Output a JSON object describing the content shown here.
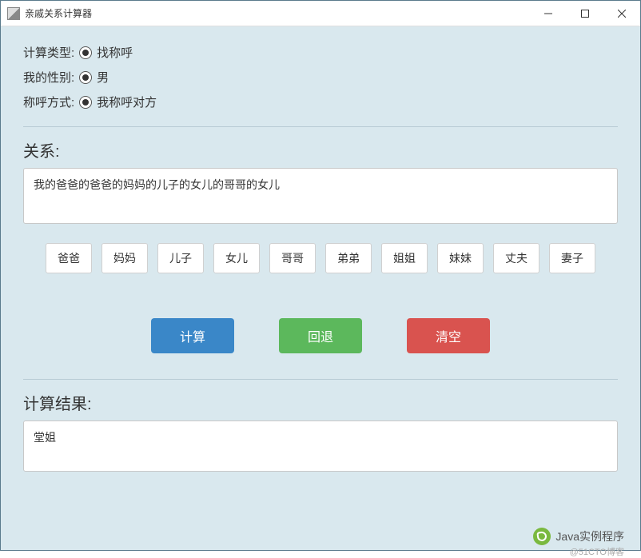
{
  "window": {
    "title": "亲戚关系计算器"
  },
  "options": {
    "calc_type_label": "计算类型:",
    "calc_type_value": "找称呼",
    "gender_label": "我的性别:",
    "gender_value": "男",
    "mode_label": "称呼方式:",
    "mode_value": "我称呼对方"
  },
  "relation": {
    "label": "关系:",
    "value": "我的爸爸的爸爸的妈妈的儿子的女儿的哥哥的女儿"
  },
  "chips": [
    "爸爸",
    "妈妈",
    "儿子",
    "女儿",
    "哥哥",
    "弟弟",
    "姐姐",
    "妹妹",
    "丈夫",
    "妻子"
  ],
  "actions": {
    "calc": "计算",
    "back": "回退",
    "clear": "清空"
  },
  "result": {
    "label": "计算结果:",
    "value": "堂姐"
  },
  "watermark": {
    "main": "Java实例程序",
    "sub": "@51CTO博客"
  }
}
